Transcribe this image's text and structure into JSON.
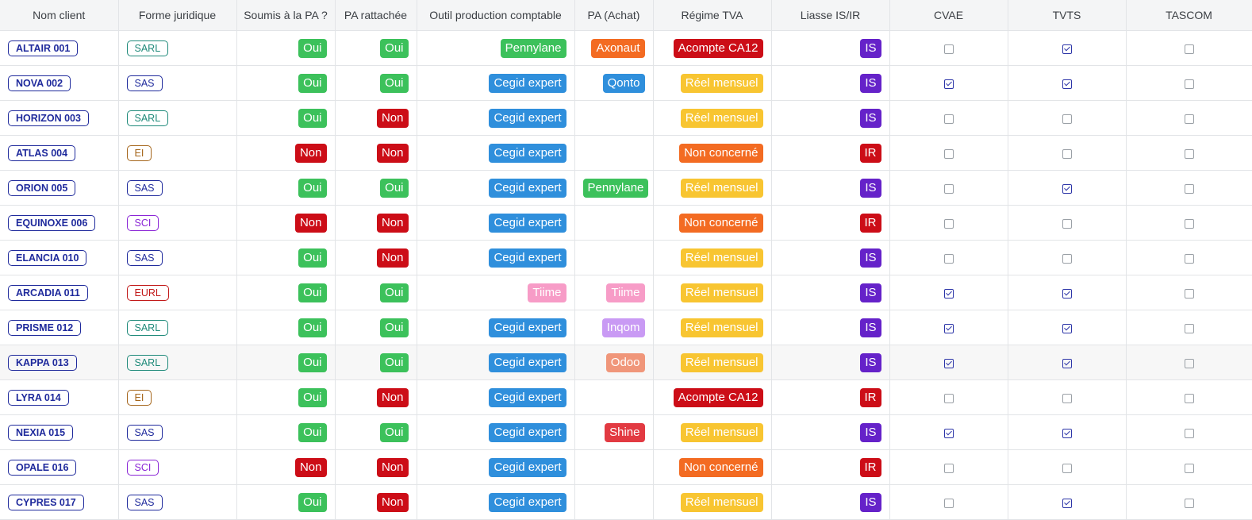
{
  "columns": [
    "Nom client",
    "Forme juridique",
    "Soumis à la PA ?",
    "PA rattachée",
    "Outil production comptable",
    "PA (Achat)",
    "Régime TVA",
    "Liasse IS/IR",
    "CVAE",
    "TVTS",
    "TASCOM"
  ],
  "colors": {
    "oui": "#3cc15b",
    "non": "#cc0d17",
    "outils": {
      "Pennylane": "#3cc15b",
      "Cegid expert": "#2f8fdc",
      "Tiime": "#f79cc7"
    },
    "achats": {
      "Axonaut": "#f36b22",
      "Qonto": "#2f8fdc",
      "Pennylane": "#3cc15b",
      "Tiime": "#f79cc7",
      "Inqom": "#c99af4",
      "Odoo": "#f0967a",
      "Shine": "#e23a42"
    },
    "regimes": {
      "Acompte CA12": "#cc0d17",
      "Réel mensuel": "#f8c531",
      "Non concerné": "#f36b22"
    },
    "liasses": {
      "IS": "#6522c9",
      "IR": "#cc0d17"
    },
    "formes": {
      "SARL": "#1f8a7a",
      "SAS": "#1f2a9c",
      "EI": "#a5661c",
      "SCI": "#8a25d6",
      "EURL": "#c21a1a"
    }
  },
  "rows": [
    {
      "client": "ALTAIR 001",
      "forme": "SARL",
      "soumis": "Oui",
      "rattachee": "Oui",
      "outil": "Pennylane",
      "achat": "Axonaut",
      "regime": "Acompte CA12",
      "liasse": "IS",
      "cvae": false,
      "tvts": true,
      "tascom": false
    },
    {
      "client": "NOVA 002",
      "forme": "SAS",
      "soumis": "Oui",
      "rattachee": "Oui",
      "outil": "Cegid expert",
      "achat": "Qonto",
      "regime": "Réel mensuel",
      "liasse": "IS",
      "cvae": true,
      "tvts": true,
      "tascom": false
    },
    {
      "client": "HORIZON 003",
      "forme": "SARL",
      "soumis": "Oui",
      "rattachee": "Non",
      "outil": "Cegid expert",
      "achat": "",
      "regime": "Réel mensuel",
      "liasse": "IS",
      "cvae": false,
      "tvts": false,
      "tascom": false
    },
    {
      "client": "ATLAS 004",
      "forme": "EI",
      "soumis": "Non",
      "rattachee": "Non",
      "outil": "Cegid expert",
      "achat": "",
      "regime": "Non concerné",
      "liasse": "IR",
      "cvae": false,
      "tvts": false,
      "tascom": false
    },
    {
      "client": "ORION 005",
      "forme": "SAS",
      "soumis": "Oui",
      "rattachee": "Oui",
      "outil": "Cegid expert",
      "achat": "Pennylane",
      "regime": "Réel mensuel",
      "liasse": "IS",
      "cvae": false,
      "tvts": true,
      "tascom": false
    },
    {
      "client": "EQUINOXE 006",
      "forme": "SCI",
      "soumis": "Non",
      "rattachee": "Non",
      "outil": "Cegid expert",
      "achat": "",
      "regime": "Non concerné",
      "liasse": "IR",
      "cvae": false,
      "tvts": false,
      "tascom": false
    },
    {
      "client": "ELANCIA 010",
      "forme": "SAS",
      "soumis": "Oui",
      "rattachee": "Non",
      "outil": "Cegid expert",
      "achat": "",
      "regime": "Réel mensuel",
      "liasse": "IS",
      "cvae": false,
      "tvts": false,
      "tascom": false
    },
    {
      "client": "ARCADIA 011",
      "forme": "EURL",
      "soumis": "Oui",
      "rattachee": "Oui",
      "outil": "Tiime",
      "achat": "Tiime",
      "regime": "Réel mensuel",
      "liasse": "IS",
      "cvae": true,
      "tvts": true,
      "tascom": false
    },
    {
      "client": "PRISME 012",
      "forme": "SARL",
      "soumis": "Oui",
      "rattachee": "Oui",
      "outil": "Cegid expert",
      "achat": "Inqom",
      "regime": "Réel mensuel",
      "liasse": "IS",
      "cvae": true,
      "tvts": true,
      "tascom": false
    },
    {
      "client": "KAPPA 013",
      "forme": "SARL",
      "soumis": "Oui",
      "rattachee": "Oui",
      "outil": "Cegid expert",
      "achat": "Odoo",
      "regime": "Réel mensuel",
      "liasse": "IS",
      "cvae": true,
      "tvts": true,
      "tascom": false
    },
    {
      "client": "LYRA 014",
      "forme": "EI",
      "soumis": "Oui",
      "rattachee": "Non",
      "outil": "Cegid expert",
      "achat": "",
      "regime": "Acompte CA12",
      "liasse": "IR",
      "cvae": false,
      "tvts": false,
      "tascom": false
    },
    {
      "client": "NEXIA 015",
      "forme": "SAS",
      "soumis": "Oui",
      "rattachee": "Oui",
      "outil": "Cegid expert",
      "achat": "Shine",
      "regime": "Réel mensuel",
      "liasse": "IS",
      "cvae": true,
      "tvts": true,
      "tascom": false
    },
    {
      "client": "OPALE 016",
      "forme": "SCI",
      "soumis": "Non",
      "rattachee": "Non",
      "outil": "Cegid expert",
      "achat": "",
      "regime": "Non concerné",
      "liasse": "IR",
      "cvae": false,
      "tvts": false,
      "tascom": false
    },
    {
      "client": "CYPRES 017",
      "forme": "SAS",
      "soumis": "Oui",
      "rattachee": "Non",
      "outil": "Cegid expert",
      "achat": "",
      "regime": "Réel mensuel",
      "liasse": "IS",
      "cvae": false,
      "tvts": true,
      "tascom": false
    }
  ]
}
